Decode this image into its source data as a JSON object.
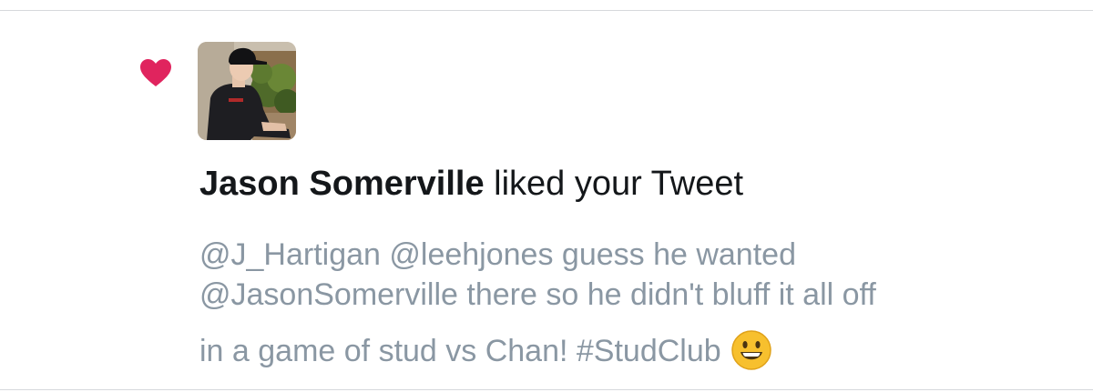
{
  "notification": {
    "icon": "heart-icon",
    "accent_color": "#e0245e",
    "actor_name": "Jason Somerville",
    "action_text": " liked your Tweet",
    "tweet": {
      "line1": "@J_Hartigan @leehjones guess he wanted",
      "line2": "@JasonSomerville there so he didn't bluff it all off",
      "line3": "in a game of stud vs Chan! #StudClub",
      "emoji": "grinning-face-emoji"
    }
  }
}
